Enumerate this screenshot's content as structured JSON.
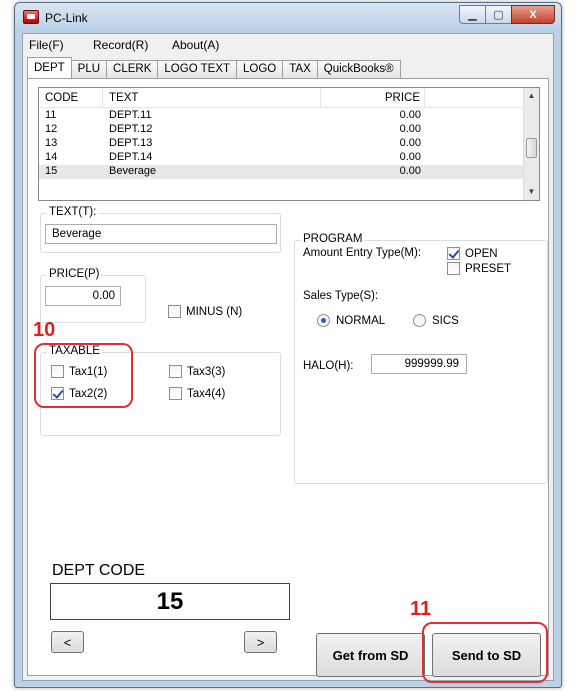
{
  "window": {
    "title": "PC-Link",
    "minimize_glyph": "▁",
    "maximize_glyph": "▢",
    "close_glyph": "X"
  },
  "menu": [
    "File(F)",
    "Record(R)",
    "About(A)"
  ],
  "tabs": [
    "DEPT",
    "PLU",
    "CLERK",
    "LOGO TEXT",
    "LOGO",
    "TAX",
    "QuickBooks®"
  ],
  "list": {
    "columns": [
      "CODE",
      "TEXT",
      "PRICE"
    ],
    "rows": [
      {
        "code": "11",
        "text": "DEPT.11",
        "price": "0.00"
      },
      {
        "code": "12",
        "text": "DEPT.12",
        "price": "0.00"
      },
      {
        "code": "13",
        "text": "DEPT.13",
        "price": "0.00"
      },
      {
        "code": "14",
        "text": "DEPT.14",
        "price": "0.00"
      },
      {
        "code": "15",
        "text": "Beverage",
        "price": "0.00"
      }
    ]
  },
  "text_group": {
    "title": "TEXT(T):",
    "value": "Beverage"
  },
  "price_group": {
    "title": "PRICE(P)",
    "value": "0.00",
    "minus_label": "MINUS (N)"
  },
  "taxable": {
    "title": "TAXABLE",
    "tax1": "Tax1(1)",
    "tax2": "Tax2(2)",
    "tax3": "Tax3(3)",
    "tax4": "Tax4(4)"
  },
  "program": {
    "title": "PROGRAM",
    "amount_entry_label": "Amount Entry Type(M):",
    "open_label": "OPEN",
    "preset_label": "PRESET",
    "sales_type_label": "Sales Type(S):",
    "normal_label": "NORMAL",
    "sics_label": "SICS",
    "halo_label": "HALO(H):",
    "halo_value": "999999.99"
  },
  "dept_code": {
    "label": "DEPT CODE",
    "value": "15",
    "prev": "<",
    "next": ">"
  },
  "buttons": {
    "get_from_sd": "Get from SD",
    "send_to_sd": "Send to SD"
  },
  "annotations": {
    "ten": "10",
    "eleven": "11",
    "color": "#e02020"
  }
}
